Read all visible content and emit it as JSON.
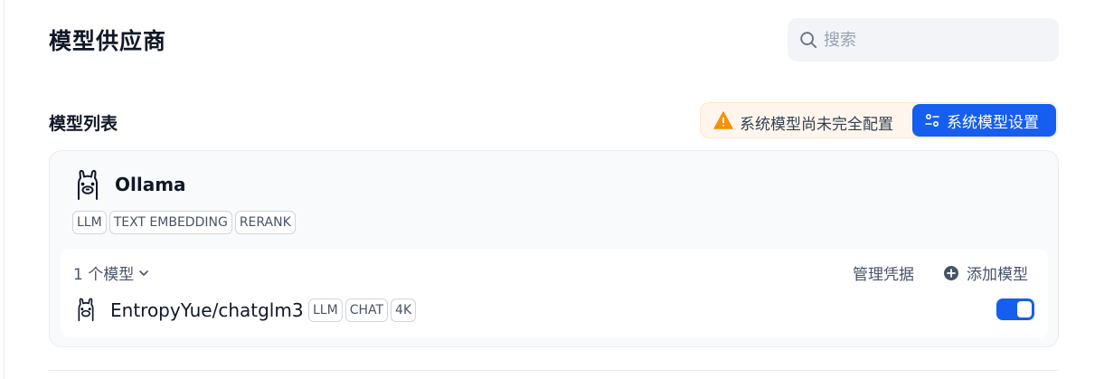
{
  "header": {
    "title": "模型供应商",
    "search_placeholder": "搜索"
  },
  "model_list": {
    "title": "模型列表",
    "warning_text": "系统模型尚未完全配置",
    "settings_button": "系统模型设置"
  },
  "provider": {
    "name": "Ollama",
    "tags": [
      "LLM",
      "TEXT EMBEDDING",
      "RERANK"
    ],
    "model_count": "1 个模型",
    "manage_credentials": "管理凭据",
    "add_model": "添加模型",
    "models": [
      {
        "name": "EntropyYue/chatglm3",
        "tags": [
          "LLM",
          "CHAT",
          "4K"
        ],
        "enabled": true
      }
    ]
  },
  "colors": {
    "accent": "#155eef",
    "warning": "#f79009"
  }
}
